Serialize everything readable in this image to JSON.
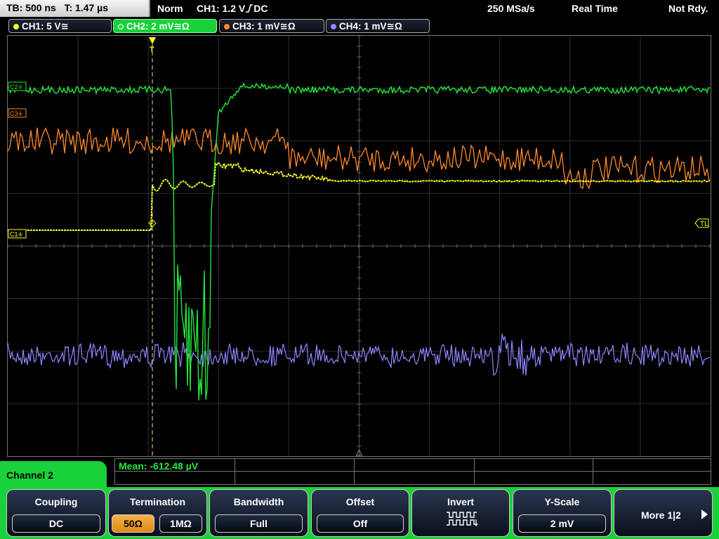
{
  "status_bar": {
    "timebase": "TB: 500 ns   T: 1.47 µs",
    "trigger_mode": "Norm",
    "trigger_info": "CH1: 1.2 V",
    "trigger_coupling": "DC",
    "sample_rate": "250 MSa/s",
    "acquisition_mode": "Real Time",
    "acquisition_state": "Not Rdy."
  },
  "channels": [
    {
      "label": "CH1: 5 V≅",
      "color": "#ffff22",
      "active": false,
      "marker": "C1",
      "icon": "ground-icon"
    },
    {
      "label": "CH2: 2 mV≅Ω",
      "color": "#22e83c",
      "active": true,
      "marker": "C2",
      "icon": "ground-icon"
    },
    {
      "label": "CH3: 1 mV≅Ω",
      "color": "#ff8a2a",
      "active": false,
      "marker": "C3",
      "icon": "ground-icon"
    },
    {
      "label": "CH4: 1 mV≅Ω",
      "color": "#8f86ff",
      "active": false,
      "marker": "C4",
      "icon": "ground-icon"
    }
  ],
  "display": {
    "trigger_level_marker": "TL",
    "trigger_position_marker": "T"
  },
  "measurement": {
    "mean": "Mean: -612.48 µV"
  },
  "menu": {
    "title": "Channel 2"
  },
  "softkeys": {
    "coupling": {
      "title": "Coupling",
      "value": "DC"
    },
    "termination": {
      "title": "Termination",
      "options": [
        "50Ω",
        "1MΩ"
      ],
      "selected": "50Ω"
    },
    "bandwidth": {
      "title": "Bandwidth",
      "value": "Full"
    },
    "offset": {
      "title": "Offset",
      "value": "Off"
    },
    "invert": {
      "title": "Invert",
      "icon": "invert-waveform-icon"
    },
    "yscale": {
      "title": "Y-Scale",
      "value": "2 mV"
    },
    "more": {
      "label": "More 1|2",
      "icon": "right-arrow-icon"
    }
  }
}
